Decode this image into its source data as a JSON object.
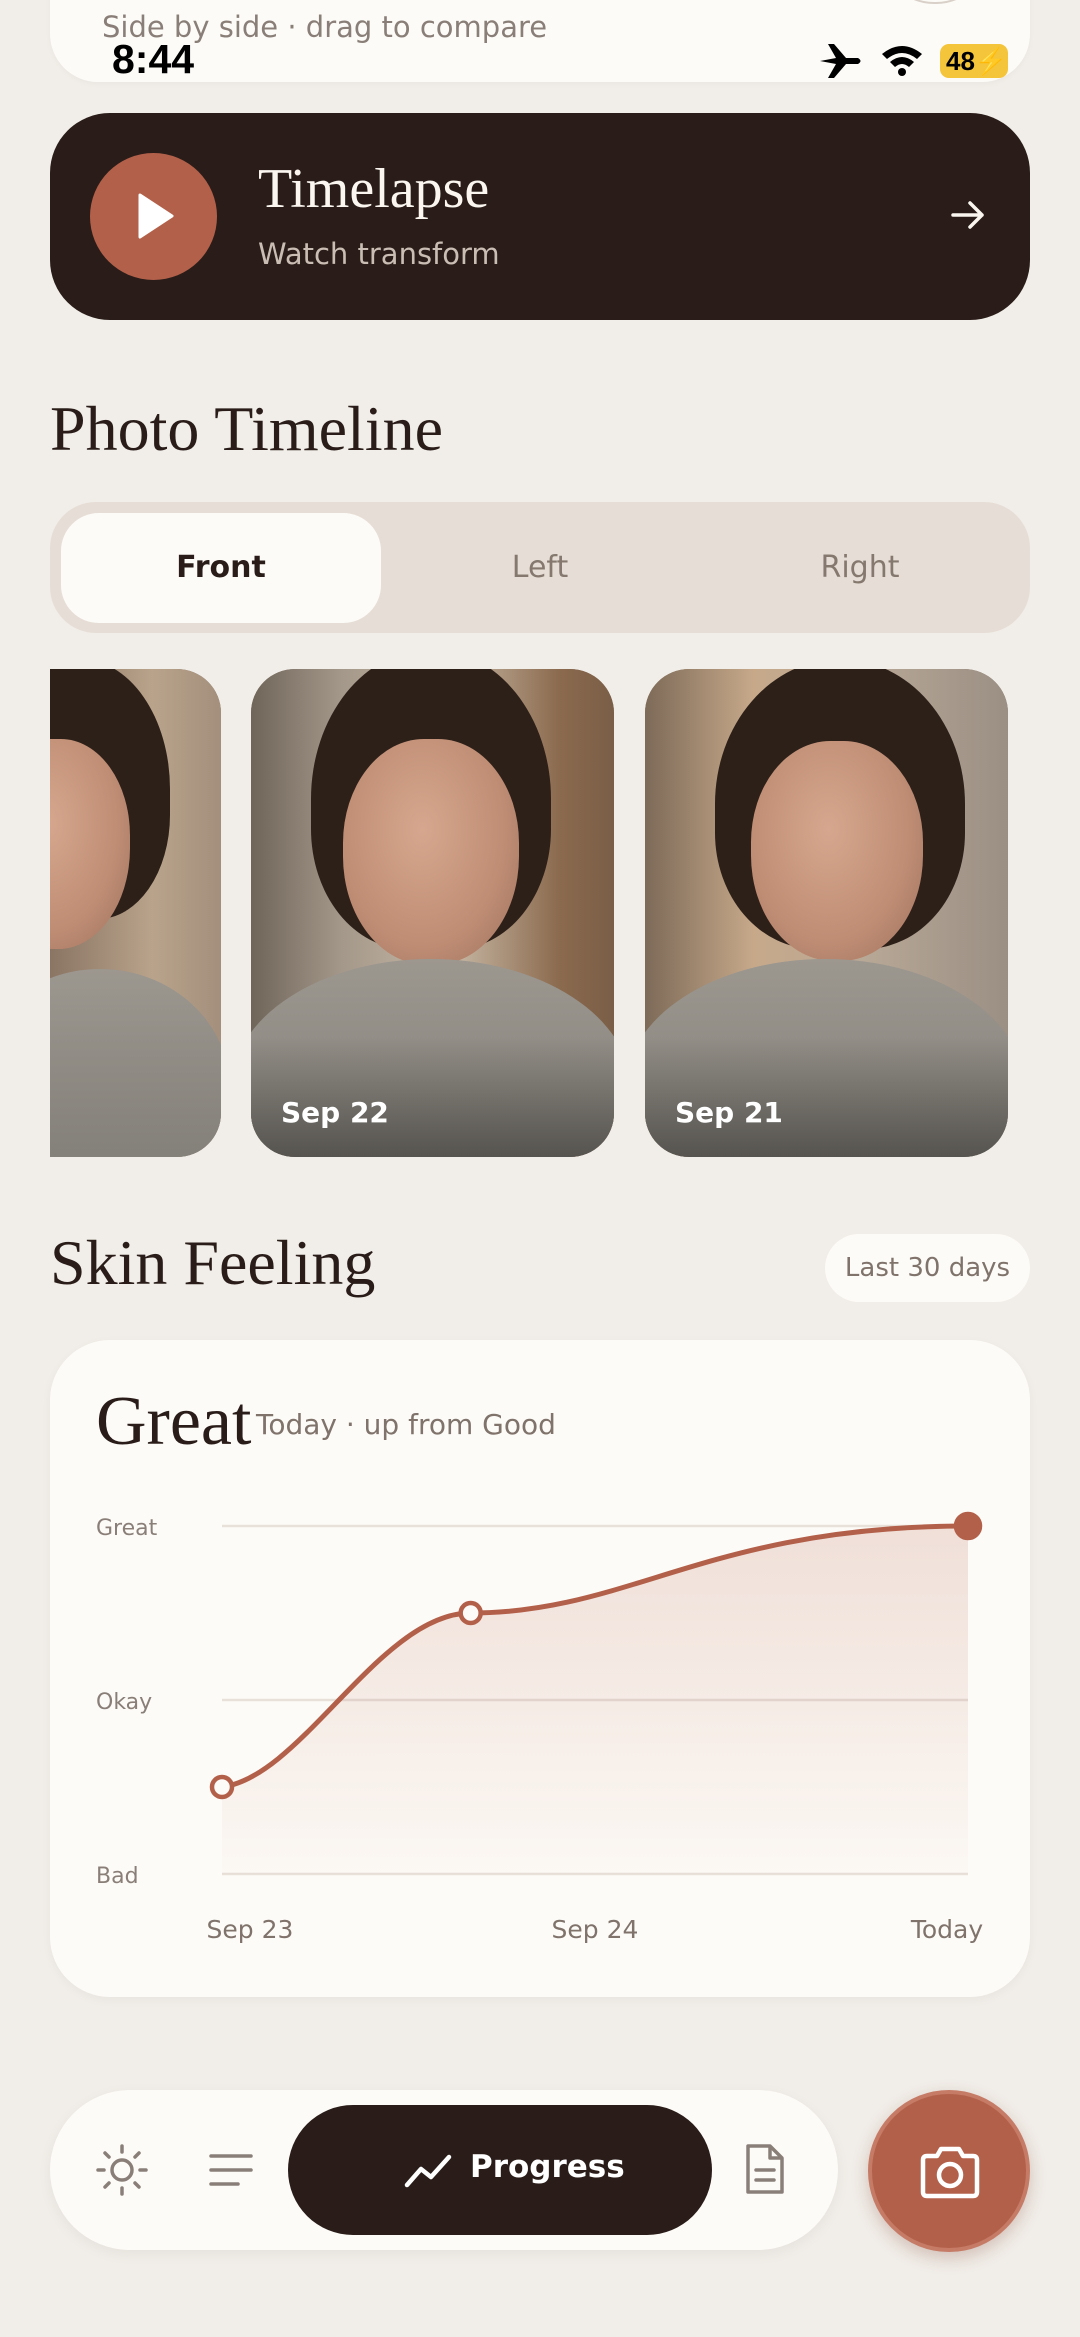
{
  "status_bar": {
    "time": "8:44",
    "battery": "48"
  },
  "compare_card": {
    "subtitle": "Side by side · drag to compare"
  },
  "timelapse": {
    "title": "Timelapse",
    "subtitle": "Watch transform"
  },
  "photo_timeline": {
    "title": "Photo Timeline",
    "tabs": [
      {
        "label": "Front",
        "active": true
      },
      {
        "label": "Left",
        "active": false
      },
      {
        "label": "Right",
        "active": false
      }
    ],
    "photos": [
      {
        "date": ""
      },
      {
        "date": "Sep 22"
      },
      {
        "date": "Sep 21"
      }
    ]
  },
  "skin_feeling": {
    "title": "Skin Feeling",
    "range_label": "Last 30 days",
    "current_value": "Great",
    "caption": "Today · up from Good"
  },
  "chart_data": {
    "type": "area",
    "title": "",
    "xlabel": "",
    "ylabel": "",
    "y_levels": [
      "Bad",
      "Okay",
      "Great"
    ],
    "x_tick_labels": [
      "Sep 23",
      "Sep 24",
      "Today"
    ],
    "series": [
      {
        "x": [
          "Sep 23",
          "Sep 23.7",
          "Today"
        ],
        "values": [
          0.5,
          1.5,
          2.0
        ]
      }
    ],
    "ylim": [
      0,
      2
    ],
    "grid": true,
    "color": "#b3604a"
  },
  "nav": {
    "progress_label": "Progress",
    "items": [
      "sun-icon",
      "list-icon",
      "progress-icon",
      "document-icon"
    ]
  },
  "colors": {
    "accent": "#b3604a",
    "dark": "#2a1d19",
    "background": "#f1ede8",
    "card": "#fdfbf7"
  }
}
